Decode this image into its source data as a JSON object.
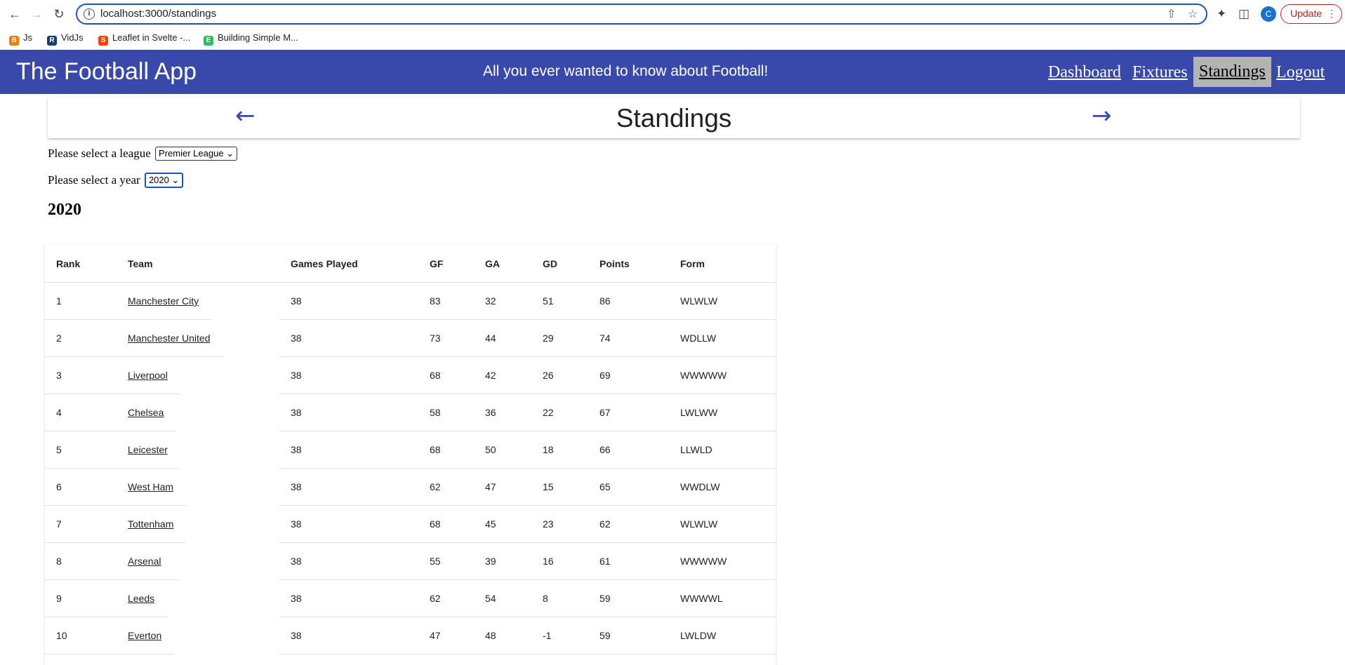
{
  "browser": {
    "url": "localhost:3000/standings",
    "update_label": "Update",
    "profile_initial": "C",
    "bookmarks": [
      {
        "label": "Js",
        "icon": "blogger-icon",
        "color": "#f57c00"
      },
      {
        "label": "VidJs",
        "icon": "r-logo-icon",
        "color": "#1b3d6e"
      },
      {
        "label": "Leaflet in Svelte -...",
        "icon": "svelte-icon",
        "color": "#ff3e00"
      },
      {
        "label": "Building Simple M...",
        "icon": "evernote-icon",
        "color": "#2dbe60"
      }
    ]
  },
  "app": {
    "title": "The Football App",
    "tagline": "All you ever wanted to know about Football!",
    "nav": [
      {
        "label": "Dashboard",
        "active": false
      },
      {
        "label": "Fixtures",
        "active": false
      },
      {
        "label": "Standings",
        "active": true
      },
      {
        "label": "Logout",
        "active": false
      }
    ],
    "brand_color": "#3949ab"
  },
  "page": {
    "title": "Standings",
    "league_prompt": "Please select a league",
    "league_selected": "Premier League",
    "year_prompt": "Please select a year",
    "year_selected": "2020",
    "heading": "2020"
  },
  "table": {
    "headers": {
      "rank": "Rank",
      "team": "Team",
      "games": "Games Played",
      "gf": "GF",
      "ga": "GA",
      "gd": "GD",
      "points": "Points",
      "form": "Form"
    },
    "rows": [
      {
        "rank": "1",
        "team": "Manchester City",
        "games": "38",
        "gf": "83",
        "ga": "32",
        "gd": "51",
        "points": "86",
        "form": "WLWLW"
      },
      {
        "rank": "2",
        "team": "Manchester United",
        "games": "38",
        "gf": "73",
        "ga": "44",
        "gd": "29",
        "points": "74",
        "form": "WDLLW"
      },
      {
        "rank": "3",
        "team": "Liverpool",
        "games": "38",
        "gf": "68",
        "ga": "42",
        "gd": "26",
        "points": "69",
        "form": "WWWWW"
      },
      {
        "rank": "4",
        "team": "Chelsea",
        "games": "38",
        "gf": "58",
        "ga": "36",
        "gd": "22",
        "points": "67",
        "form": "LWLWW"
      },
      {
        "rank": "5",
        "team": "Leicester",
        "games": "38",
        "gf": "68",
        "ga": "50",
        "gd": "18",
        "points": "66",
        "form": "LLWLD"
      },
      {
        "rank": "6",
        "team": "West Ham",
        "games": "38",
        "gf": "62",
        "ga": "47",
        "gd": "15",
        "points": "65",
        "form": "WWDLW"
      },
      {
        "rank": "7",
        "team": "Tottenham",
        "games": "38",
        "gf": "68",
        "ga": "45",
        "gd": "23",
        "points": "62",
        "form": "WLWLW"
      },
      {
        "rank": "8",
        "team": "Arsenal",
        "games": "38",
        "gf": "55",
        "ga": "39",
        "gd": "16",
        "points": "61",
        "form": "WWWWW"
      },
      {
        "rank": "9",
        "team": "Leeds",
        "games": "38",
        "gf": "62",
        "ga": "54",
        "gd": "8",
        "points": "59",
        "form": "WWWWL"
      },
      {
        "rank": "10",
        "team": "Everton",
        "games": "38",
        "gf": "47",
        "ga": "48",
        "gd": "-1",
        "points": "59",
        "form": "LWLDW"
      }
    ]
  }
}
